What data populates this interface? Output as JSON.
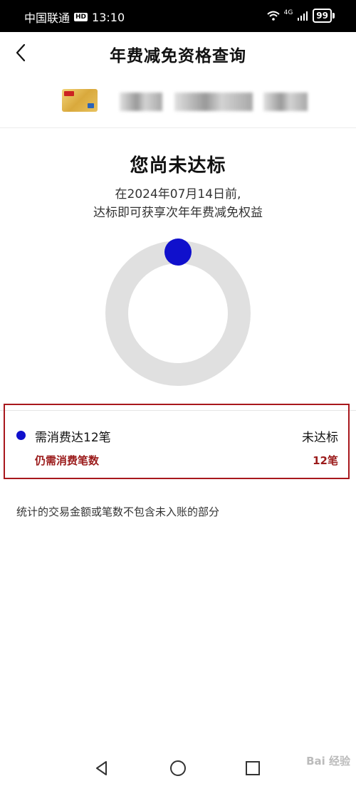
{
  "status_bar": {
    "carrier": "中国联通",
    "hd": "HD",
    "time": "13:10",
    "network": "4G",
    "battery": "99"
  },
  "header": {
    "title": "年费减免资格查询"
  },
  "result": {
    "title": "您尚未达标",
    "desc_line1": "在2024年07月14日前,",
    "desc_line2": "达标即可获享次年年费减免权益"
  },
  "progress": {
    "fraction": 0,
    "track_color": "#e0e0e0",
    "indicator_color": "#1010cc"
  },
  "requirement": {
    "label": "需消费达12笔",
    "status": "未达标",
    "remaining_label": "仍需消费笔数",
    "remaining_value": "12笔"
  },
  "footnote": "统计的交易金额或笔数不包含未入账的部分",
  "watermark": "Bai 经验"
}
